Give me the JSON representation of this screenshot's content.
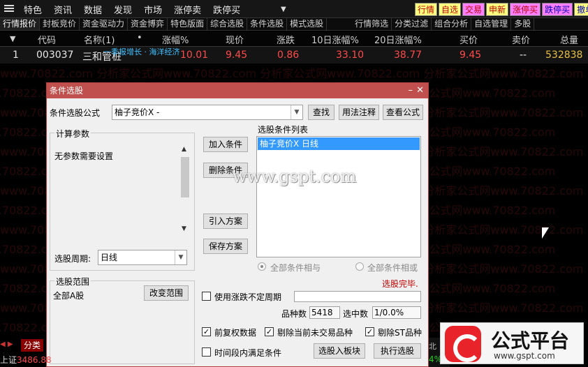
{
  "menubar": {
    "items": [
      "特色",
      "资讯",
      "数据",
      "发现",
      "市场",
      "涨停卖",
      "跌停买"
    ],
    "quick_buttons": [
      {
        "label": "行情",
        "bg": "#ffff80",
        "fg": "#c00000"
      },
      {
        "label": "自选",
        "bg": "#ffff80",
        "fg": "#c00000"
      },
      {
        "label": "交易",
        "bg": "#ff80ff",
        "fg": "#c00000"
      },
      {
        "label": "申新",
        "bg": "#ffff80",
        "fg": "#c00000"
      },
      {
        "label": "涨停买",
        "bg": "#ff80ff",
        "fg": "#c00000"
      },
      {
        "label": "跌停买",
        "bg": "#ff80ff",
        "fg": "#0000c0"
      },
      {
        "label": "撤单",
        "bg": "#ffff80",
        "fg": "#0000c0"
      }
    ]
  },
  "tabs": [
    "行情报价",
    "封板竞价",
    "资金驱动力",
    "资金博弈",
    "特色版面",
    "综合选股",
    "条件选股",
    "模式选股",
    "行情筛选",
    "分类过滤",
    "组合分析",
    "自选管理",
    "多股"
  ],
  "table": {
    "columns": [
      "代码",
      "名称(1)",
      "•",
      "涨幅%",
      "现价",
      "涨跌",
      "10日涨幅%",
      "20日涨幅%",
      "买价",
      "卖价",
      "总量"
    ],
    "row": {
      "index": "1",
      "code": "003037",
      "name": "三和管桩",
      "pct": "10.01",
      "price": "9.45",
      "change": "0.86",
      "pct10": "33.10",
      "pct20": "38.77",
      "bid": "9.45",
      "ask": "--",
      "volume": "532838"
    },
    "note": "一季报增长 · 海洋经济"
  },
  "watermark_text": "www.70822.com 分析家公式网www.70822.com 分析家公式网www.70822.com 分析家公式网www.70822.com",
  "dialog": {
    "title": "条件选股",
    "formula_label": "条件选股公式",
    "formula_value": "柚子竞价X  -",
    "btn_find": "查找",
    "btn_usage": "用法注释",
    "btn_view": "查看公式",
    "params_group": "计算参数",
    "params_text": "无参数需要设置",
    "period_label": "选股周期:",
    "period_value": "日线",
    "btn_add": "加入条件",
    "btn_delete": "删除条件",
    "btn_import": "引入方案",
    "btn_save": "保存方案",
    "list_label": "选股条件列表",
    "list_item": "柚子竞价X  日线",
    "radio_and": "全部条件相与",
    "radio_or": "全部条件相或",
    "status": "选股完毕.",
    "range_group": "选股范围",
    "range_text": "全部A股",
    "btn_change_range": "改变范围",
    "chk_variable_period": "使用涨跌不定周期",
    "count_label": "品种数",
    "count_value": "5418",
    "selected_label": "选中数",
    "selected_value": "1/0.0%",
    "chk_adjust": "前复权数据",
    "chk_remove_untraded": "剔除当前未交易品种",
    "chk_remove_st": "剔除ST品种",
    "chk_time_range": "时间段内满足条件",
    "btn_to_block": "选股入板块",
    "btn_execute": "执行选股",
    "watermark": "www.gspt.com"
  },
  "bottom": {
    "category": "分类",
    "index_name": "上证",
    "index_value": "3486.88",
    "right_pct": "4%"
  },
  "logo": {
    "name": "公式平台",
    "url": "www.gspt.com"
  }
}
